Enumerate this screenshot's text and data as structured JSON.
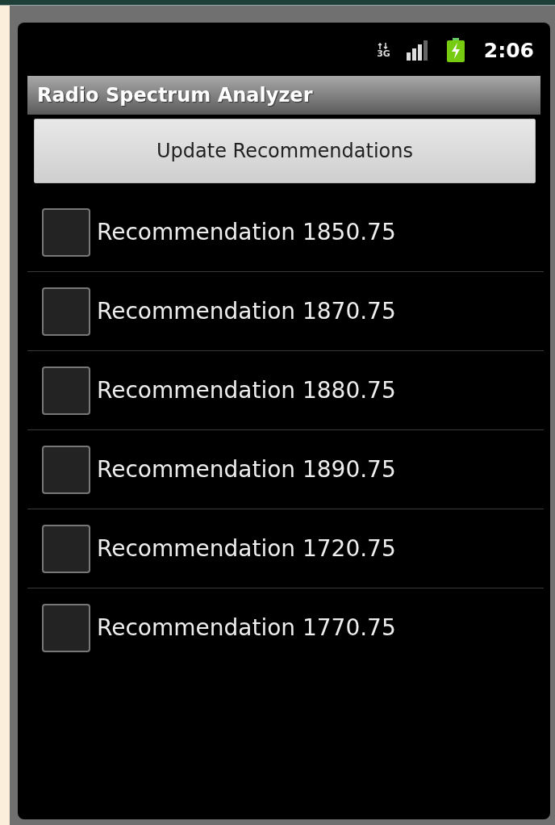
{
  "status_bar": {
    "network_type": "3G",
    "time": "2:06"
  },
  "title_bar": {
    "title": "Radio Spectrum Analyzer"
  },
  "update_button": {
    "label": "Update Recommendations"
  },
  "recommendations": [
    {
      "label": "Recommendation 1850.75",
      "checked": false
    },
    {
      "label": "Recommendation 1870.75",
      "checked": false
    },
    {
      "label": "Recommendation 1880.75",
      "checked": false
    },
    {
      "label": "Recommendation 1890.75",
      "checked": false
    },
    {
      "label": "Recommendation 1720.75",
      "checked": false
    },
    {
      "label": "Recommendation 1770.75",
      "checked": false
    }
  ]
}
